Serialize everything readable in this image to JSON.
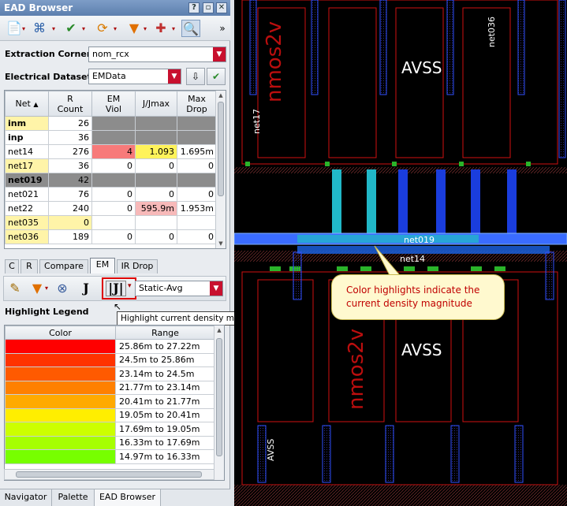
{
  "window": {
    "title": "EAD Browser"
  },
  "extraction_corner": {
    "label": "Extraction Corner:",
    "value": "nom_rcx"
  },
  "electrical_dataset": {
    "label": "Electrical Dataset:",
    "value": "EMData"
  },
  "net_table": {
    "headers": [
      "Net",
      "R\nCount",
      "EM\nViol",
      "J/Jmax",
      "Max\nDrop"
    ],
    "rows": [
      {
        "net": "inm",
        "rcount": "26",
        "emviol": "",
        "jjmax": "",
        "maxdrop": ""
      },
      {
        "net": "inp",
        "rcount": "36",
        "emviol": "",
        "jjmax": "",
        "maxdrop": ""
      },
      {
        "net": "net14",
        "rcount": "276",
        "emviol": "4",
        "jjmax": "1.093",
        "maxdrop": "1.695m"
      },
      {
        "net": "net17",
        "rcount": "36",
        "emviol": "0",
        "jjmax": "0",
        "maxdrop": "0"
      },
      {
        "net": "net019",
        "rcount": "42",
        "emviol": "",
        "jjmax": "",
        "maxdrop": ""
      },
      {
        "net": "net021",
        "rcount": "76",
        "emviol": "0",
        "jjmax": "0",
        "maxdrop": "0"
      },
      {
        "net": "net22",
        "rcount": "240",
        "emviol": "0",
        "jjmax": "595.9m",
        "maxdrop": "1.953m"
      },
      {
        "net": "net035",
        "rcount": "0",
        "emviol": "",
        "jjmax": "",
        "maxdrop": ""
      },
      {
        "net": "net036",
        "rcount": "189",
        "emviol": "0",
        "jjmax": "0",
        "maxdrop": "0"
      }
    ]
  },
  "tabs": [
    "C",
    "R",
    "Compare",
    "EM",
    "IR Drop"
  ],
  "active_tab": "EM",
  "em_mode": {
    "value": "Static-Avg"
  },
  "tooltip": "Highlight current density magnitude",
  "legend": {
    "title": "Highlight Legend",
    "headers": [
      "Color",
      "Range"
    ],
    "rows": [
      {
        "color": "#ff0000",
        "range": "25.86m to 27.22m"
      },
      {
        "color": "#ff3300",
        "range": "24.5m to 25.86m"
      },
      {
        "color": "#ff5a00",
        "range": "23.14m to 24.5m"
      },
      {
        "color": "#ff8000",
        "range": "21.77m to 23.14m"
      },
      {
        "color": "#ffaa00",
        "range": "20.41m to 21.77m"
      },
      {
        "color": "#ffee00",
        "range": "19.05m to 20.41m"
      },
      {
        "color": "#ccff00",
        "range": "17.69m to 19.05m"
      },
      {
        "color": "#a6ff00",
        "range": "16.33m to 17.69m"
      },
      {
        "color": "#77ff00",
        "range": "14.97m to 16.33m"
      }
    ]
  },
  "bottom_tabs": [
    "Navigator",
    "Palette",
    "EAD Browser"
  ],
  "bottom_active": "EAD Browser",
  "layout_view": {
    "callout": "Color highlights indicate the current density magnitude",
    "labels": {
      "avss_top": "AVSS",
      "avss_mid": "AVSS",
      "avss_bottom": "AVSS",
      "net019": "net019",
      "net14": "net14",
      "net17": "net17",
      "net036": "net036",
      "nmos2v": "nmos2v"
    }
  }
}
